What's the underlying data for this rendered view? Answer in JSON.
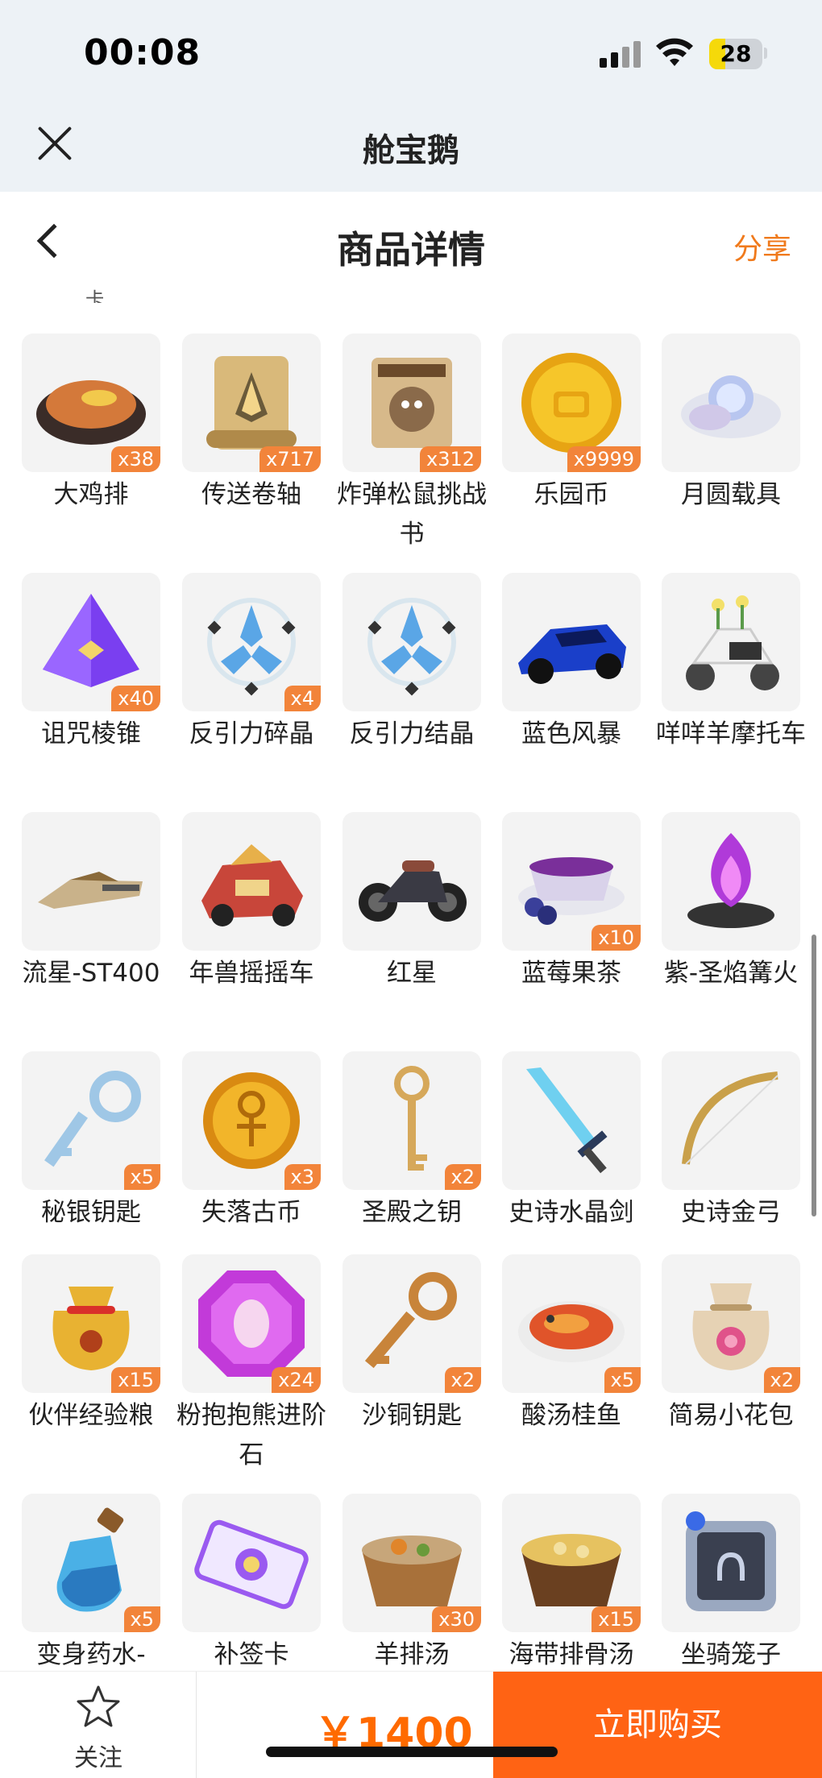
{
  "status_bar": {
    "time": "00:08",
    "battery": "28"
  },
  "mini_app": {
    "title": "舱宝鹅"
  },
  "nav": {
    "title": "商品详情",
    "share": "分享"
  },
  "cut_text": "卡",
  "items": [
    {
      "name": "大鸡排",
      "count": "x38",
      "icon": "fried-chicken-icon"
    },
    {
      "name": "传送卷轴",
      "count": "x717",
      "icon": "teleport-scroll-icon"
    },
    {
      "name": "炸弹松鼠挑战书",
      "count": "x312",
      "icon": "wanted-poster-icon"
    },
    {
      "name": "乐园币",
      "count": "x9999",
      "icon": "gold-coin-icon"
    },
    {
      "name": "月圆载具",
      "count": "",
      "icon": "moon-cloud-icon"
    },
    {
      "name": "诅咒棱锥",
      "count": "x40",
      "icon": "purple-pyramid-icon"
    },
    {
      "name": "反引力碎晶",
      "count": "x4",
      "icon": "crystal-shard-icon"
    },
    {
      "name": "反引力结晶",
      "count": "",
      "icon": "crystal-icon"
    },
    {
      "name": "蓝色风暴",
      "count": "",
      "icon": "race-car-icon"
    },
    {
      "name": "咩咩羊摩托车",
      "count": "",
      "icon": "scooter-icon"
    },
    {
      "name": "流星-ST400",
      "count": "",
      "icon": "hover-bike-icon"
    },
    {
      "name": "年兽摇摇车",
      "count": "",
      "icon": "dragon-cart-icon"
    },
    {
      "name": "红星",
      "count": "",
      "icon": "motorcycle-icon"
    },
    {
      "name": "蓝莓果茶",
      "count": "x10",
      "icon": "blueberry-tea-icon"
    },
    {
      "name": "紫-圣焰篝火",
      "count": "",
      "icon": "bonfire-icon"
    },
    {
      "name": "秘银钥匙",
      "count": "x5",
      "icon": "silver-key-icon"
    },
    {
      "name": "失落古币",
      "count": "x3",
      "icon": "ancient-coin-icon"
    },
    {
      "name": "圣殿之钥",
      "count": "x2",
      "icon": "temple-key-icon"
    },
    {
      "name": "史诗水晶剑",
      "count": "",
      "icon": "crystal-sword-icon"
    },
    {
      "name": "史诗金弓",
      "count": "",
      "icon": "golden-bow-icon"
    },
    {
      "name": "伙伴经验粮",
      "count": "x15",
      "icon": "food-bag-icon"
    },
    {
      "name": "粉抱抱熊进阶石",
      "count": "x24",
      "icon": "pink-gem-icon"
    },
    {
      "name": "沙铜钥匙",
      "count": "x2",
      "icon": "bronze-key-icon"
    },
    {
      "name": "酸汤桂鱼",
      "count": "x5",
      "icon": "fish-soup-icon"
    },
    {
      "name": "简易小花包",
      "count": "x2",
      "icon": "flower-bag-icon"
    },
    {
      "name": "变身药水-",
      "count": "x5",
      "icon": "potion-icon"
    },
    {
      "name": "补签卡",
      "count": "",
      "icon": "ticket-icon"
    },
    {
      "name": "羊排汤",
      "count": "x30",
      "icon": "lamb-soup-icon"
    },
    {
      "name": "海带排骨汤",
      "count": "x15",
      "icon": "rib-soup-icon"
    },
    {
      "name": "坐骑笼子",
      "count": "",
      "icon": "mount-cage-icon"
    }
  ],
  "bottom": {
    "follow": "关注",
    "price": "￥1400",
    "buy": "立即购买"
  }
}
